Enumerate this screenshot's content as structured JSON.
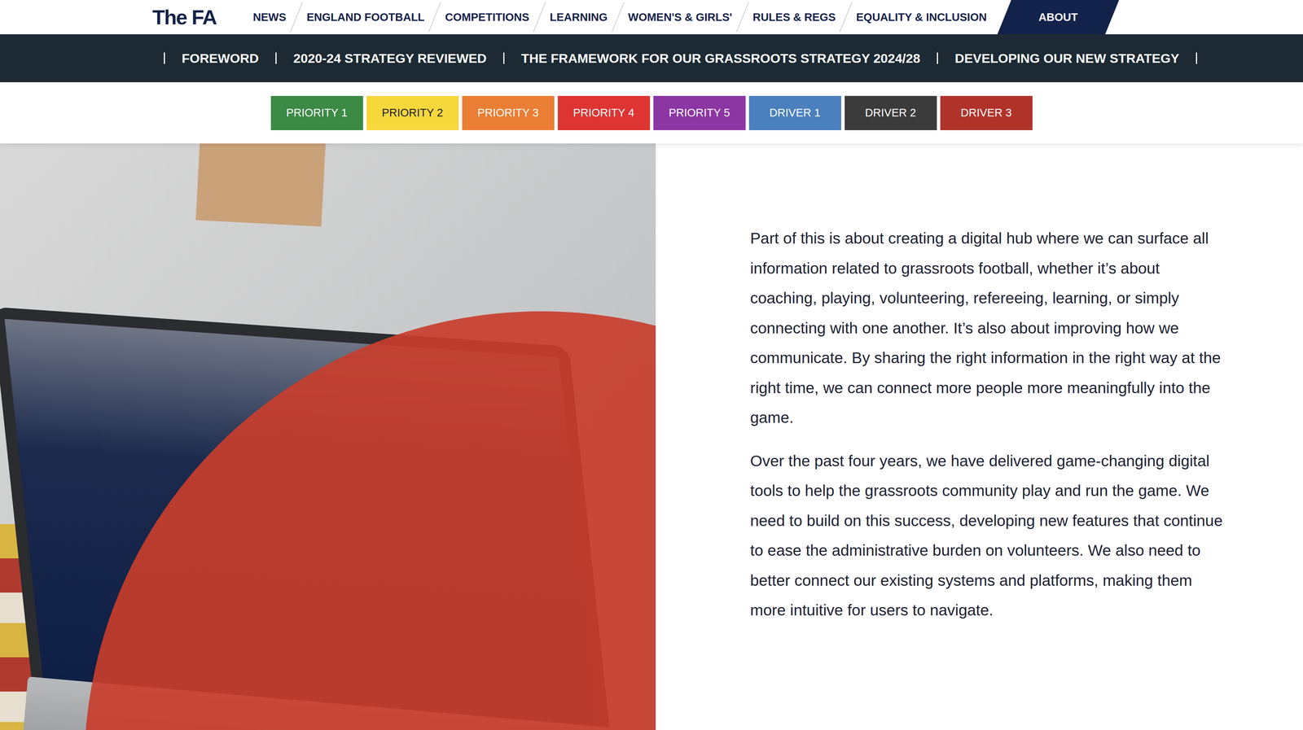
{
  "logo": "The FA",
  "nav": [
    {
      "label": "NEWS",
      "selected": false
    },
    {
      "label": "ENGLAND FOOTBALL",
      "selected": false
    },
    {
      "label": "COMPETITIONS",
      "selected": false
    },
    {
      "label": "LEARNING",
      "selected": false
    },
    {
      "label": "WOMEN'S & GIRLS'",
      "selected": false
    },
    {
      "label": "RULES & REGS",
      "selected": false
    },
    {
      "label": "EQUALITY & INCLUSION",
      "selected": false
    },
    {
      "label": "ABOUT",
      "selected": true
    }
  ],
  "subnav": [
    "FOREWORD",
    "2020-24 STRATEGY REVIEWED",
    "THE FRAMEWORK FOR OUR GRASSROOTS STRATEGY 2024/28",
    "DEVELOPING OUR NEW STRATEGY"
  ],
  "priorities": [
    {
      "label": "PRIORITY 1",
      "color": "#3b8a45"
    },
    {
      "label": "PRIORITY 2",
      "color": "#f6d83d"
    },
    {
      "label": "PRIORITY 3",
      "color": "#ea7e34"
    },
    {
      "label": "PRIORITY 4",
      "color": "#de3532"
    },
    {
      "label": "PRIORITY 5",
      "color": "#8b36a3"
    },
    {
      "label": "DRIVER 1",
      "color": "#4b80bf"
    },
    {
      "label": "DRIVER 2",
      "color": "#3b3b3b"
    },
    {
      "label": "DRIVER 3",
      "color": "#b0332a"
    }
  ],
  "paragraphs": [
    "Part of this is about creating a digital hub where we can surface all information related to grassroots football, whether it’s about coaching, playing, volunteering, refereeing, learning, or simply connecting with one another. It’s also about improving how we communicate. By sharing the right information in the right way at the right time, we can connect more people more meaningfully into the game.",
    "Over the past four years, we have delivered game-changing digital tools to help the grassroots community play and run the game. We need to build on this success, developing new features that continue to ease the administrative burden on volunteers. We also need to better connect our existing systems and platforms, making them more intuitive for users to navigate."
  ]
}
